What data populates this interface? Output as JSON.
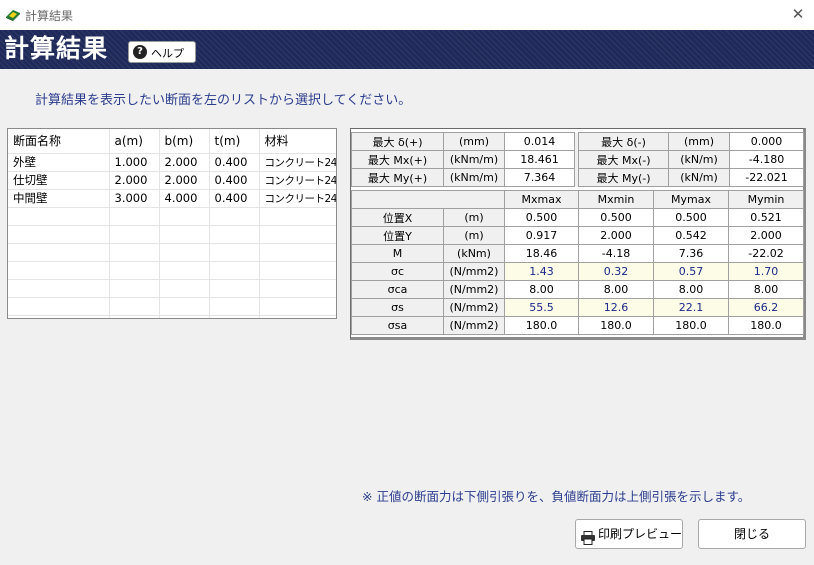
{
  "window": {
    "title": "計算結果",
    "close_glyph": "✕"
  },
  "header": {
    "heading": "計算結果",
    "help_label": "ヘルプ",
    "help_glyph": "?"
  },
  "instruction": "計算結果を表示したい断面を左のリストから選択してください。",
  "section_list": {
    "columns": [
      "断面名称",
      "a(m)",
      "b(m)",
      "t(m)",
      "材料"
    ],
    "rows": [
      [
        "外壁",
        "1.000",
        "2.000",
        "0.400",
        "コンクリート24"
      ],
      [
        "仕切壁",
        "2.000",
        "2.000",
        "0.400",
        "コンクリート24"
      ],
      [
        "中間壁",
        "3.000",
        "4.000",
        "0.400",
        "コンクリート24"
      ]
    ]
  },
  "summary": [
    {
      "label_left": "最大 δ(+)",
      "unit_left": "(mm)",
      "value_left": "0.014",
      "label_right": "最大 δ(-)",
      "unit_right": "(mm)",
      "value_right": "0.000"
    },
    {
      "label_left": "最大 Mx(+)",
      "unit_left": "(kNm/m)",
      "value_left": "18.461",
      "label_right": "最大 Mx(-)",
      "unit_right": "(kN/m)",
      "value_right": "-4.180"
    },
    {
      "label_left": "最大 My(+)",
      "unit_left": "(kNm/m)",
      "value_left": "7.364",
      "label_right": "最大 My(-)",
      "unit_right": "(kN/m)",
      "value_right": "-22.021"
    }
  ],
  "results": {
    "columns": [
      "Mxmax",
      "Mxmin",
      "Mymax",
      "Mymin"
    ],
    "rows": [
      {
        "label": "位置X",
        "unit": "(m)",
        "values": [
          "0.500",
          "0.500",
          "0.500",
          "0.521"
        ]
      },
      {
        "label": "位置Y",
        "unit": "(m)",
        "values": [
          "0.917",
          "2.000",
          "0.542",
          "2.000"
        ]
      },
      {
        "label": "M",
        "unit": "(kNm)",
        "values": [
          "18.46",
          "-4.18",
          "7.36",
          "-22.02"
        ]
      },
      {
        "label": "σc",
        "unit": "(N/mm2)",
        "values": [
          "1.43",
          "0.32",
          "0.57",
          "1.70"
        ]
      },
      {
        "label": "σca",
        "unit": "(N/mm2)",
        "values": [
          "8.00",
          "8.00",
          "8.00",
          "8.00"
        ]
      },
      {
        "label": "σs",
        "unit": "(N/mm2)",
        "values": [
          "55.5",
          "12.6",
          "22.1",
          "66.2"
        ]
      },
      {
        "label": "σsa",
        "unit": "(N/mm2)",
        "values": [
          "180.0",
          "180.0",
          "180.0",
          "180.0"
        ]
      }
    ]
  },
  "note": "※ 正値の断面力は下側引張りを、負値断面力は上側引張を示します。",
  "buttons": {
    "print_preview": "印刷プレビュー",
    "close": "閉じる"
  },
  "colors": {
    "header_bg": "#1f2a5a",
    "accent_text": "#2b3d8f",
    "highlight_bg": "#fdfce6",
    "highlight_text": "#1a2a8a"
  }
}
